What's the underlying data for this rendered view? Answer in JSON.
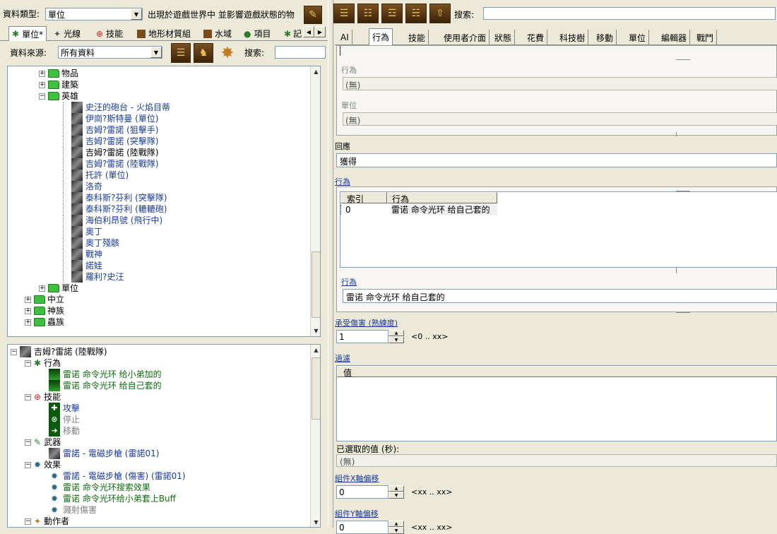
{
  "top": {
    "type_label": "資料類型:",
    "type_value": "單位",
    "appears_text": "出現於遊戲世界中 並影響遊戲狀態的物",
    "search_label": "搜索:"
  },
  "left_tabs": [
    {
      "label": "單位*"
    },
    {
      "label": "光線"
    },
    {
      "label": "技能"
    },
    {
      "label": "地形材質組"
    },
    {
      "label": "水域"
    },
    {
      "label": "項目"
    },
    {
      "label": "記"
    }
  ],
  "source": {
    "label": "資料來源:",
    "value": "所有資料",
    "search_label": "搜索:"
  },
  "tree_top": {
    "folders_top": [
      "物品",
      "建築",
      "英雄"
    ],
    "heroes": [
      {
        "label": "史汪的砲台 - 火焰目蒂",
        "color": "blue"
      },
      {
        "label": "伊崗?斯特曼 (單位)",
        "color": "blue"
      },
      {
        "label": "吉姆?雷諾 (狙擊手)",
        "color": "blue"
      },
      {
        "label": "吉姆?雷諾 (突擊隊)",
        "color": "blue"
      },
      {
        "label": "吉姆?雷諾 (陸戰隊)",
        "color": "black"
      },
      {
        "label": "吉姆?雷諾 (陸戰隊)",
        "color": "blue"
      },
      {
        "label": "托許 (單位)",
        "color": "blue"
      },
      {
        "label": "洛奇",
        "color": "blue"
      },
      {
        "label": "泰科斯?芬利 (突擊隊)",
        "color": "blue"
      },
      {
        "label": "泰科斯?芬利 (轆轆砲)",
        "color": "blue"
      },
      {
        "label": "海伯利昂號 (飛行中)",
        "color": "blue"
      },
      {
        "label": "奧丁",
        "color": "blue"
      },
      {
        "label": "奧丁殘骸",
        "color": "blue"
      },
      {
        "label": "戰神",
        "color": "blue"
      },
      {
        "label": "諾娃",
        "color": "blue"
      },
      {
        "label": "羅利?史汪",
        "color": "blue"
      }
    ],
    "folders_bottom": [
      "單位",
      "中立",
      "神族",
      "蟲族"
    ]
  },
  "tree_bottom": {
    "root": "吉姆?雷諾 (陸戰隊)",
    "behaviors_label": "行為",
    "behaviors": [
      "雷诺 命令光环 给小弟加的",
      "雷诺 命令光环 给自己套的"
    ],
    "abilities_label": "技能",
    "abilities": [
      {
        "label": "攻擊",
        "color": "blue"
      },
      {
        "label": "停止",
        "color": "gray"
      },
      {
        "label": "移動",
        "color": "gray"
      }
    ],
    "weapons_label": "武器",
    "weapons": [
      "雷諾 - 電磁步槍 (雷諾01)"
    ],
    "effects_label": "效果",
    "effects": [
      {
        "label": "雷諾 - 電磁步槍 (傷害) (雷諾01)",
        "color": "blue"
      },
      {
        "label": "雷诺 命令光环搜索效果",
        "color": "green"
      },
      {
        "label": "雷诺 命令光环给小弟套上Buff",
        "color": "green"
      },
      {
        "label": "濺射傷害",
        "color": "gray"
      }
    ],
    "actors_label": "動作者"
  },
  "right": {
    "search_label": "搜索:",
    "tabs": [
      "AI",
      "行為",
      "技能",
      "使用者介面",
      "狀態",
      "花費",
      "科技樹",
      "移動",
      "單位",
      "編輯器",
      "戰鬥"
    ],
    "behavior_label": "行為",
    "behavior_value": "(無)",
    "unit_label": "單位",
    "unit_value": "(無)",
    "response_label": "回應",
    "response_value": "獲得",
    "behaviors_link": "行為",
    "table_headers": [
      "索引",
      "行為"
    ],
    "table_rows": [
      {
        "index": "0",
        "behavior": "雷诺 命令光环 给自己套的"
      }
    ],
    "behavior_link2": "行為",
    "behavior_value2": "雷诺 命令光环 给自己套的",
    "damage_link": "承受傷害 (熟練度)",
    "damage_value": "1",
    "damage_range": "<0 .. xx>",
    "filter_link": "過濾",
    "filter_header": "值",
    "selected_label": "已選取的值 (秒):",
    "selected_value": "(無)",
    "offset_x_link": "組件X軸偏移",
    "offset_x_value": "0",
    "offset_x_range": "<xx .. xx>",
    "offset_y_link": "組件Y軸偏移",
    "offset_y_value": "0",
    "offset_y_range": "<xx .. xx>"
  }
}
